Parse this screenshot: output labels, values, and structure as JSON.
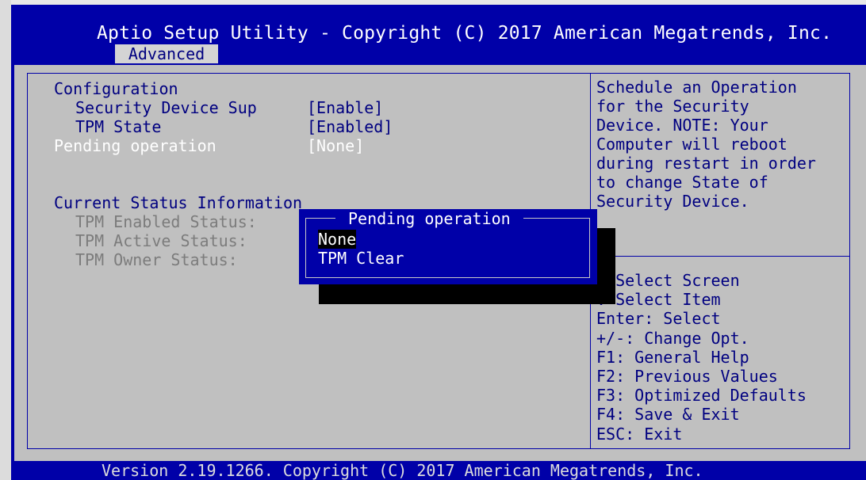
{
  "header": {
    "title": "Aptio Setup Utility - Copyright (C) 2017 American Megatrends, Inc.",
    "active_tab": "Advanced"
  },
  "main": {
    "section_configuration": "Configuration",
    "security_device_label": "Security Device Sup",
    "security_device_value": "[Enable]",
    "tpm_state_label": "TPM State",
    "tpm_state_value": "[Enabled]",
    "pending_label": "Pending operation",
    "pending_value": "[None]",
    "section_status": "Current Status Information",
    "tpm_enabled_label": "TPM Enabled Status:",
    "tpm_active_label": "TPM Active Status:",
    "tpm_owner_label": "TPM Owner Status:"
  },
  "help": {
    "text": "Schedule an Operation\nfor the Security\nDevice. NOTE: Your\nComputer will reboot\nduring restart in order\nto change State of\nSecurity Device."
  },
  "keys": [
    ": Select Screen",
    ": Select Item",
    "Enter: Select",
    "+/-: Change Opt.",
    "F1: General Help",
    "F2: Previous Values",
    "F3: Optimized Defaults",
    "F4: Save & Exit",
    "ESC: Exit"
  ],
  "popup": {
    "title": "Pending operation",
    "options": [
      "None",
      "TPM Clear"
    ],
    "selected_index": 0
  },
  "footer": {
    "text": "Version 2.19.1266. Copyright (C) 2017 American Megatrends, Inc."
  },
  "colors": {
    "bios_blue": "#0000a8",
    "panel_gray": "#c0c0c0",
    "text_dark_blue": "#000080",
    "disabled_gray": "#7c7c7c",
    "highlight_black": "#000000"
  }
}
